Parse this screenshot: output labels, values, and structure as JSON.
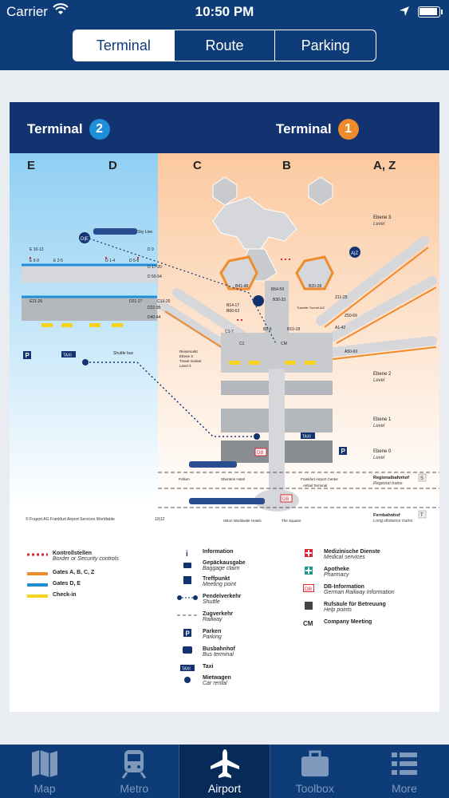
{
  "status": {
    "carrier": "Carrier",
    "time": "10:50 PM",
    "battery_level": 0.95
  },
  "segments": [
    {
      "label": "Terminal",
      "active": true
    },
    {
      "label": "Route",
      "active": false
    },
    {
      "label": "Parking",
      "active": false
    }
  ],
  "map": {
    "terminal2_label": "Terminal",
    "terminal2_num": "2",
    "terminal1_label": "Terminal",
    "terminal1_num": "1",
    "terminal2_color": "#1e8ed8",
    "terminal1_color": "#f08b2c",
    "zones": [
      "E",
      "D",
      "C",
      "B",
      "A, Z"
    ],
    "levels": [
      {
        "name": "Ebene 3",
        "sub": "Level"
      },
      {
        "name": "Ebene 2",
        "sub": "Level"
      },
      {
        "name": "Ebene 1",
        "sub": "Level"
      },
      {
        "name": "Ebene 0",
        "sub": "Level"
      }
    ],
    "sky_line": "Sky Line",
    "shuttle_bus": "Shuttle bus",
    "taxi": "TAXI",
    "gates_d_e": [
      "E 10-13",
      "E 6-9",
      "E 2-5",
      "D 1-4",
      "D 5-8",
      "D 9",
      "D 17-20",
      "D 50-54",
      "E21-26",
      "D21-27",
      "C13-20",
      "D22-35",
      "D40-44"
    ],
    "gates_abc": [
      "B41-48",
      "B54-59",
      "B20-28",
      "B14-17",
      "B60-63",
      "B30-33",
      "Z11-25",
      "Z50-69",
      "A1-42",
      "A50-69",
      "C1-7",
      "C1",
      "B1-9",
      "B10-18"
    ],
    "travel_market": [
      "Reisemarkt",
      "Ebene 3",
      "Travel market",
      "Level 3"
    ],
    "transfer_label": "Transfer Tunnel A/Z",
    "bottom_labels": [
      "Pollum",
      "Sheraton Hotel",
      "Frankfurt Airport Center",
      "AIRail Terminal",
      "Hilton Worldwide Hotels",
      "The Squaire"
    ],
    "regional": {
      "name": "Regionalbahnhof",
      "sub": "Regional trains",
      "badge": "S"
    },
    "fernbahnhof": {
      "name": "Fernbahnhof",
      "sub": "Long-distance trains",
      "badge": "T"
    },
    "copyright": "© Fraport AG   Frankfurt Airport Services Worldwide",
    "copyright_date": "10|12",
    "cm": "CM",
    "db": "DB"
  },
  "legend": {
    "col1": [
      {
        "name": "Kontrollstellen",
        "sub": "Border or Security controls"
      },
      {
        "name": "Gates A, B, C, Z",
        "sub": ""
      },
      {
        "name": "Gates D, E",
        "sub": ""
      },
      {
        "name": "Check-in",
        "sub": ""
      }
    ],
    "col2": [
      {
        "name": "Information",
        "sub": ""
      },
      {
        "name": "Gepäckausgabe",
        "sub": "Baggage claim"
      },
      {
        "name": "Treffpunkt",
        "sub": "Meeting point"
      },
      {
        "name": "Pendelverkehr",
        "sub": "Shuttle"
      },
      {
        "name": "Zugverkehr",
        "sub": "Railway"
      },
      {
        "name": "Parken",
        "sub": "Parking"
      },
      {
        "name": "Busbahnhof",
        "sub": "Bus terminal"
      },
      {
        "name": "Taxi",
        "sub": ""
      },
      {
        "name": "Mietwagen",
        "sub": "Car rental"
      }
    ],
    "col3": [
      {
        "name": "Medizinische Dienste",
        "sub": "Medical services"
      },
      {
        "name": "Apotheke",
        "sub": "Pharmacy"
      },
      {
        "name": "DB-Information",
        "sub": "German Railway Information"
      },
      {
        "name": "Rufsäule für Betreuung",
        "sub": "Help points"
      },
      {
        "name": "Company Meeting",
        "sub": ""
      }
    ],
    "colors": {
      "security": "#d9262e",
      "gates_abc": "#f08b2c",
      "gates_de": "#1e8ed8",
      "checkin": "#f5d21e"
    }
  },
  "tabs": [
    {
      "label": "Map",
      "icon": "map-icon",
      "active": false
    },
    {
      "label": "Metro",
      "icon": "train-icon",
      "active": false
    },
    {
      "label": "Airport",
      "icon": "airplane-icon",
      "active": true
    },
    {
      "label": "Toolbox",
      "icon": "toolbox-icon",
      "active": false
    },
    {
      "label": "More",
      "icon": "list-icon",
      "active": false
    }
  ]
}
